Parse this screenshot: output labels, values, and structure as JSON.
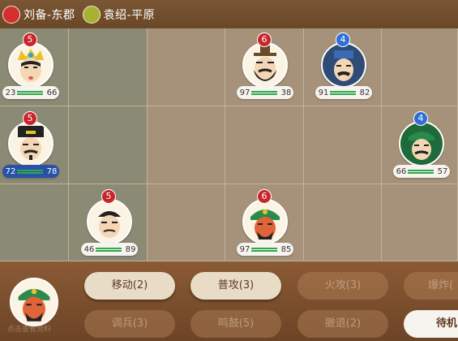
{
  "factions": [
    {
      "name": "刘备-东郡",
      "color": "#d42e2e"
    },
    {
      "name": "袁绍-平原",
      "color": "#a8b132"
    }
  ],
  "units": [
    {
      "id": "u1",
      "level": "5",
      "side": "red",
      "hp": "23",
      "max": "66",
      "face": "yellow-crown"
    },
    {
      "id": "u2",
      "level": "6",
      "side": "red",
      "hp": "97",
      "max": "38",
      "face": "bearded"
    },
    {
      "id": "u3",
      "level": "4",
      "side": "blue",
      "hp": "91",
      "max": "82",
      "face": "blue-hat"
    },
    {
      "id": "u4",
      "level": "5",
      "side": "red",
      "hp": "72",
      "max": "78",
      "face": "black-hat",
      "selected": true
    },
    {
      "id": "u5",
      "level": "4",
      "side": "blue",
      "hp": "66",
      "max": "57",
      "face": "green-general"
    },
    {
      "id": "u6",
      "level": "5",
      "side": "red",
      "hp": "46",
      "max": "89",
      "face": "bald"
    },
    {
      "id": "u7",
      "level": "6",
      "side": "red",
      "hp": "97",
      "max": "85",
      "face": "red-face"
    }
  ],
  "commands": {
    "move": "移动(2)",
    "attack": "普攻(3)",
    "fire": "火攻(3)",
    "explode": "爆炸(",
    "troops": "调兵(3)",
    "drum": "鸣鼓(5)",
    "retreat": "撤退(2)",
    "standby": "待机"
  },
  "general_label": "点击查看资料"
}
